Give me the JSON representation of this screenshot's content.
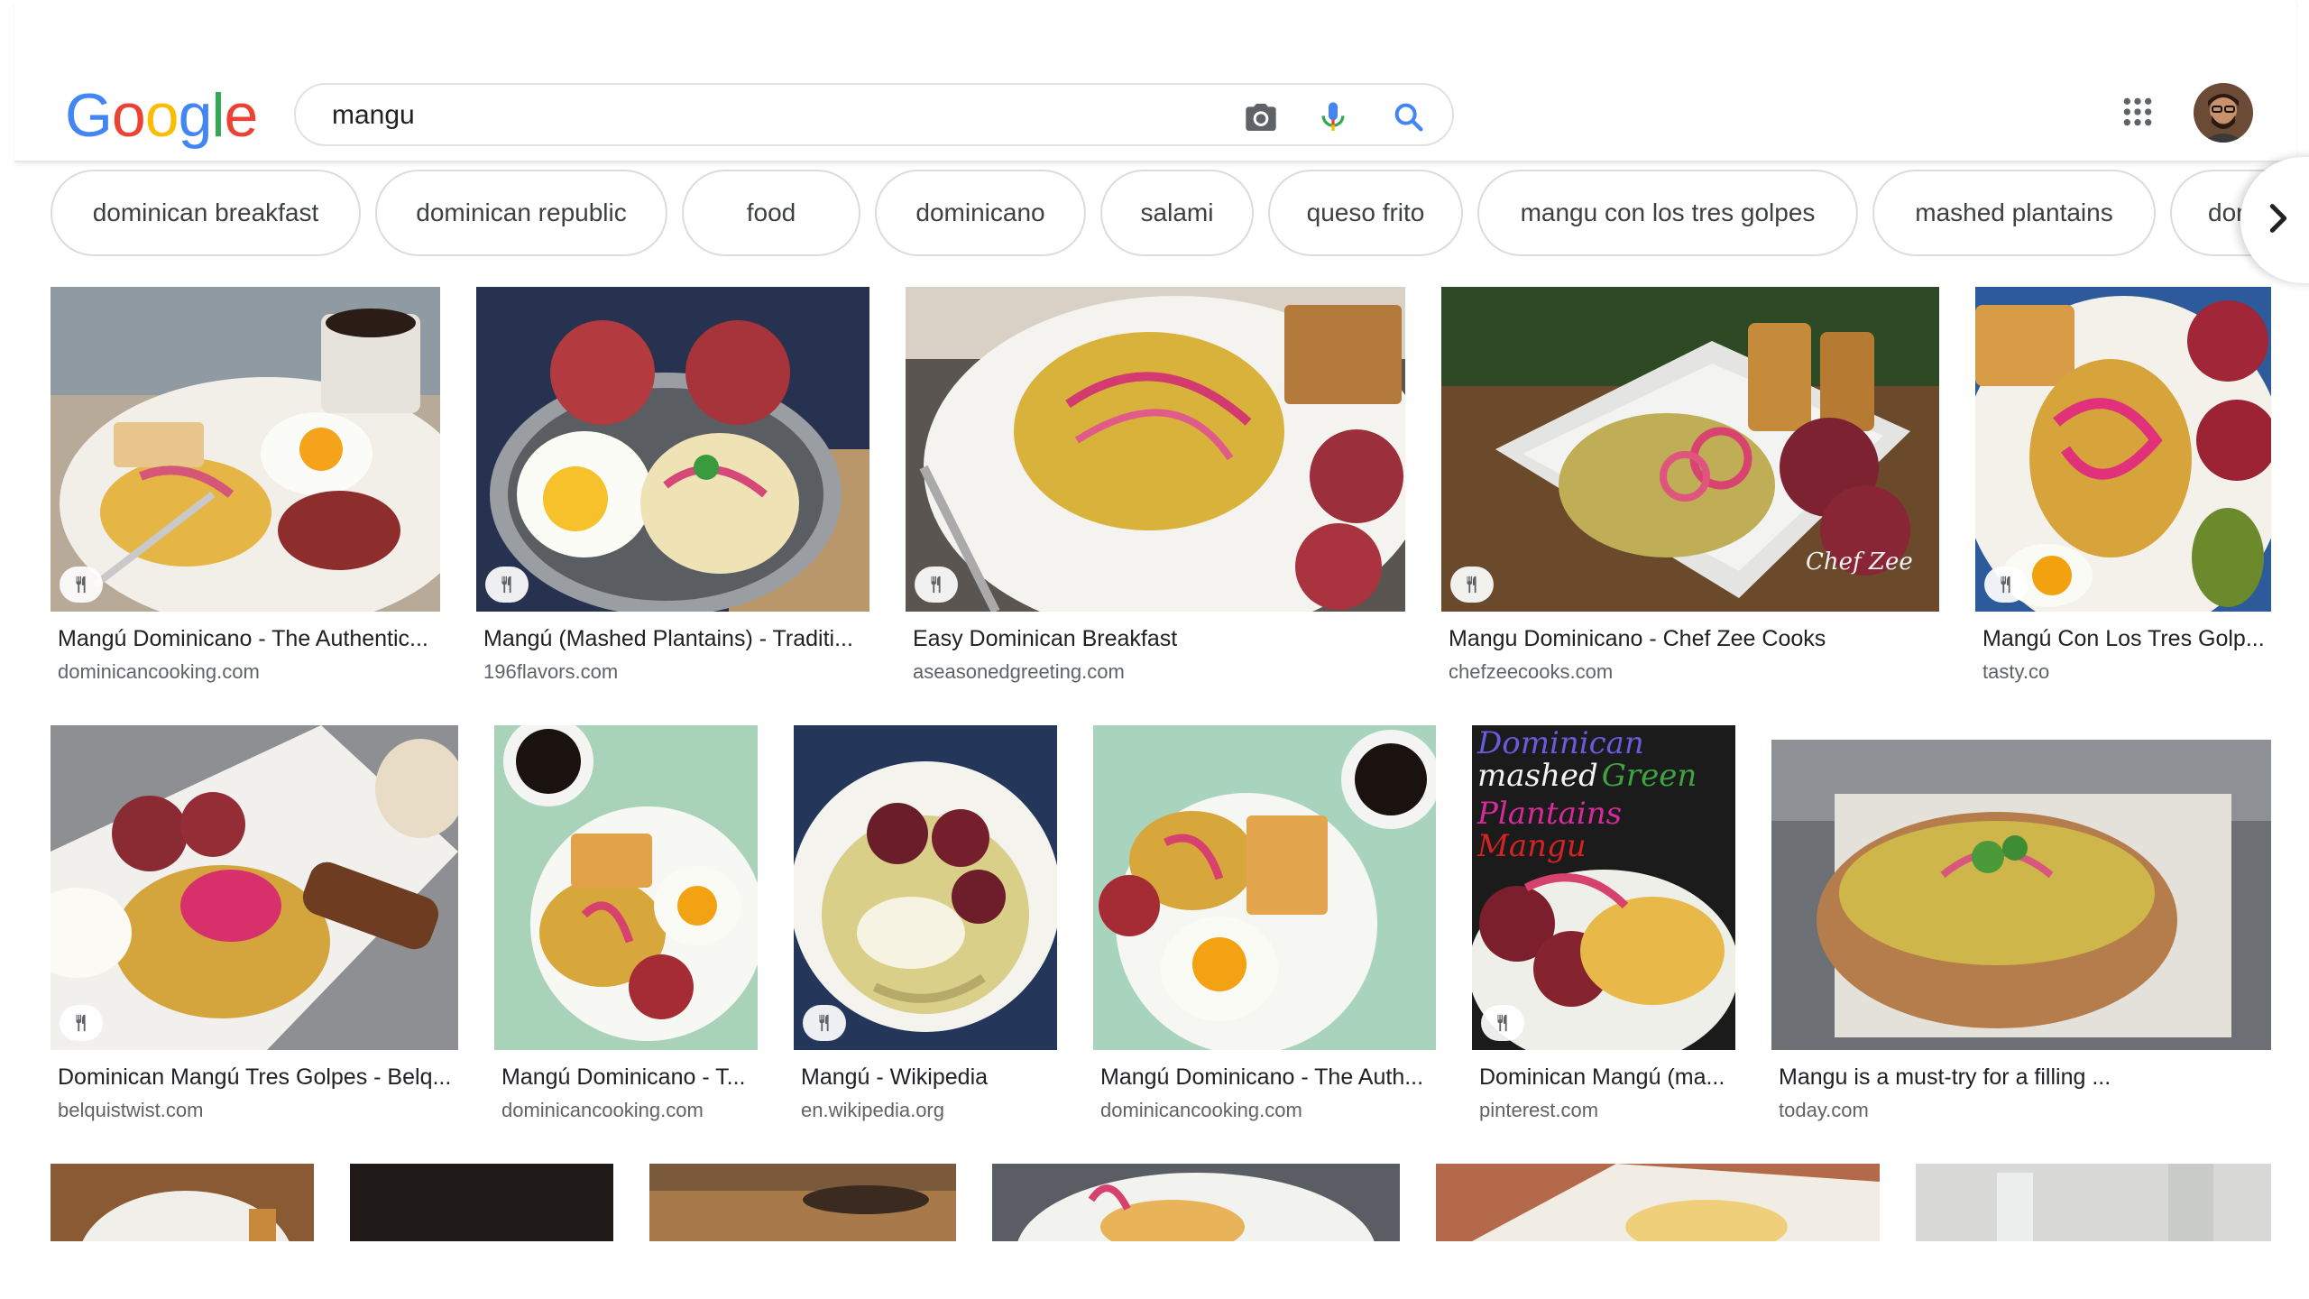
{
  "search": {
    "query": "mangu",
    "logo_letters": [
      {
        "char": "G",
        "color": "#4285F4"
      },
      {
        "char": "o",
        "color": "#EA4335"
      },
      {
        "char": "o",
        "color": "#FBBC05"
      },
      {
        "char": "g",
        "color": "#4285F4"
      },
      {
        "char": "l",
        "color": "#34A853"
      },
      {
        "char": "e",
        "color": "#EA4335"
      }
    ],
    "icons": [
      "camera-icon",
      "microphone-icon",
      "search-icon"
    ]
  },
  "chips": [
    "dominican breakfast",
    "dominican republic",
    "food",
    "dominicano",
    "salami",
    "queso frito",
    "mangu con los tres golpes",
    "mashed plantains",
    "dominican"
  ],
  "results": [
    {
      "title": "Mangú Dominicano - The Authentic...",
      "site": "dominicancooking.com",
      "recipe": true
    },
    {
      "title": "Mangú (Mashed Plantains) - Traditi...",
      "site": "196flavors.com",
      "recipe": true
    },
    {
      "title": "Easy Dominican Breakfast",
      "site": "aseasonedgreeting.com",
      "recipe": true
    },
    {
      "title": "Mangu Dominicano - Chef Zee Cooks",
      "site": "chefzeecooks.com",
      "recipe": true
    },
    {
      "title": "Mangú Con Los Tres Golp...",
      "site": "tasty.co",
      "recipe": true
    },
    {
      "title": "Dominican Mangú Tres Golpes - Belq...",
      "site": "belquistwist.com",
      "recipe": true
    },
    {
      "title": "Mangú Dominicano - T...",
      "site": "dominicancooking.com",
      "recipe": false
    },
    {
      "title": "Mangú - Wikipedia",
      "site": "en.wikipedia.org",
      "recipe": true
    },
    {
      "title": "Mangú Dominicano - The Auth...",
      "site": "dominicancooking.com",
      "recipe": false
    },
    {
      "title": "Dominican Mangú (ma...",
      "site": "pinterest.com",
      "recipe": true
    },
    {
      "title": "Mangu is a must-try for a filling ...",
      "site": "today.com",
      "recipe": false
    }
  ],
  "image_overlays": {
    "chefzee_watermark": "Chef Zee",
    "pinterest_title_lines": [
      "Dominican",
      "mashed",
      "Green",
      "Plantains",
      "Mangu"
    ]
  },
  "colors": {
    "accent_blue": "#4285F4",
    "mic_red": "#EA4335",
    "chip_border": "#dadce0",
    "title_text": "#202124",
    "site_text": "#5f6368"
  }
}
